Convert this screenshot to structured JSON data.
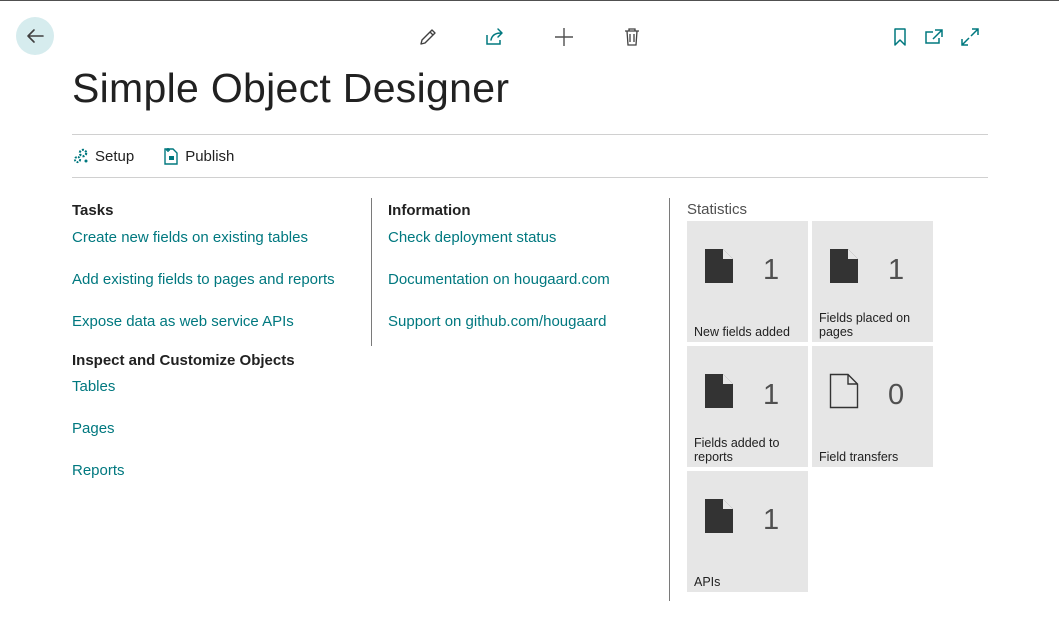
{
  "header": {
    "title": "Simple Object Designer",
    "icons": [
      "back-arrow-icon",
      "pencil-icon",
      "share-icon",
      "plus-icon",
      "trash-icon",
      "bookmark-icon",
      "open-new-window-icon",
      "expand-icon"
    ]
  },
  "actions": [
    {
      "label": "Setup",
      "icon": "setup-gears-icon"
    },
    {
      "label": "Publish",
      "icon": "publish-icon"
    }
  ],
  "tasks": {
    "heading": "Tasks",
    "links": [
      "Create new fields on existing tables",
      "Add existing fields to pages and reports",
      "Expose data as web service APIs"
    ]
  },
  "inspect": {
    "heading": "Inspect and Customize Objects",
    "links": [
      "Tables",
      "Pages",
      "Reports"
    ]
  },
  "information": {
    "heading": "Information",
    "links": [
      "Check deployment status",
      "Documentation on hougaard.com",
      "Support on github.com/hougaard"
    ]
  },
  "statistics": {
    "heading": "Statistics",
    "tiles": [
      {
        "value": "1",
        "label": "New fields added",
        "icon": "filled-document-icon"
      },
      {
        "value": "1",
        "label": "Fields placed on pages",
        "icon": "filled-document-icon"
      },
      {
        "value": "1",
        "label": "Fields added to reports",
        "icon": "filled-document-icon"
      },
      {
        "value": "0",
        "label": "Field transfers",
        "icon": "outline-document-icon"
      },
      {
        "value": "1",
        "label": "APIs",
        "icon": "filled-document-icon"
      }
    ]
  },
  "colors": {
    "accent": "#00787f",
    "tile_bg": "#e6e6e6",
    "back_bg": "#d6ecee"
  }
}
